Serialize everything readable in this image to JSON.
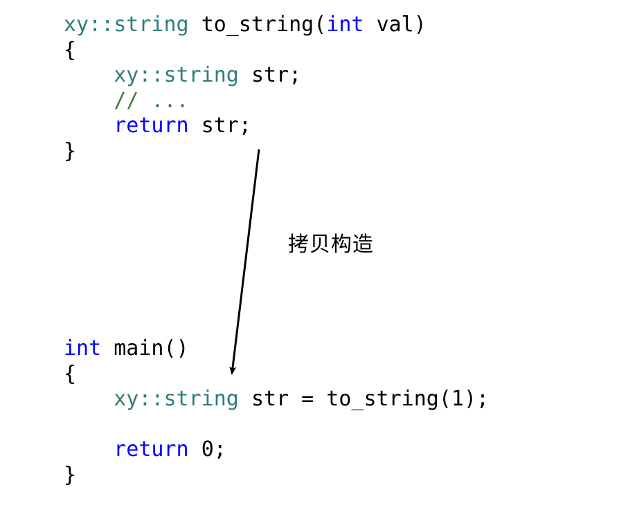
{
  "code_top": {
    "l1": {
      "ns": "xy",
      "sep": "::",
      "ty": "string",
      "sp": " ",
      "fn": "to_string",
      "op": "(",
      "kw": "int",
      "sp2": " ",
      "arg": "val",
      "cl": ")"
    },
    "l2": "{",
    "l3": {
      "indent": "    ",
      "ns": "xy",
      "sep": "::",
      "ty": "string",
      "sp": " ",
      "var": "str;"
    },
    "l4": {
      "indent": "    ",
      "cmt": "// ..."
    },
    "l5": {
      "indent": "    ",
      "kw": "return",
      "sp": " ",
      "expr": "str;"
    },
    "l6": "}"
  },
  "code_bottom": {
    "l1": {
      "kw": "int",
      "sp": " ",
      "fn": "main()"
    },
    "l2": "{",
    "l3": {
      "indent": "    ",
      "ns": "xy",
      "sep": "::",
      "ty": "string",
      "sp": " ",
      "rest": "str = to_string(1);"
    },
    "l4": "",
    "l5": {
      "indent": "    ",
      "kw": "return",
      "sp": " ",
      "expr": "0;"
    },
    "l6": "}"
  },
  "annotation": "拷贝构造"
}
